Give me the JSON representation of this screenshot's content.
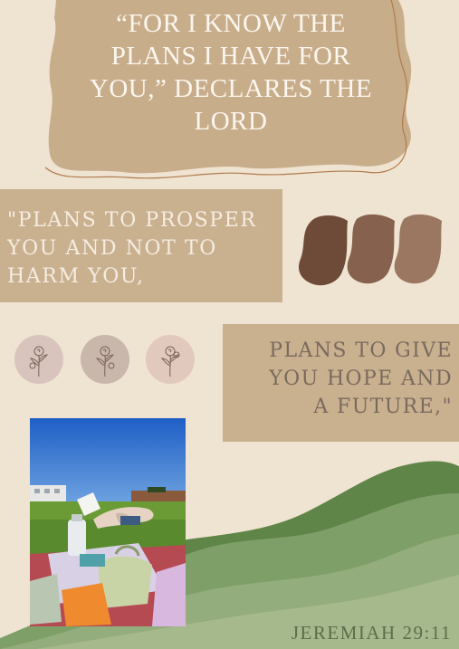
{
  "headline": {
    "line1": "“FOR I KNOW THE",
    "line2": "PLANS I HAVE FOR",
    "line3": "YOU,” DECLARES THE",
    "line4": "LORD"
  },
  "quote_left": {
    "line1": "\"PLANS TO PROSPER",
    "line2": "YOU AND NOT TO",
    "line3": "HARM YOU,"
  },
  "quote_right": {
    "line1": "PLANS TO GIVE",
    "line2": "YOU HOPE AND",
    "line3": "A FUTURE,\""
  },
  "reference": "JEREMIAH 29:11",
  "palette": {
    "background": "#efe3d1",
    "tan": "#c9b08f",
    "headline_blob": "#c8ad8b",
    "swatch1": "#6e4b38",
    "swatch2": "#86614d",
    "swatch3": "#9b7762",
    "circle1": "#d8c4bc",
    "circle2": "#c9b7ac",
    "circle3": "#e2c9bd",
    "green_dark": "#5f8548",
    "green_mid": "#7f9f68",
    "green_light": "#a6b98c"
  },
  "icons": [
    "rose-icon",
    "rose-icon",
    "rose-icon"
  ]
}
